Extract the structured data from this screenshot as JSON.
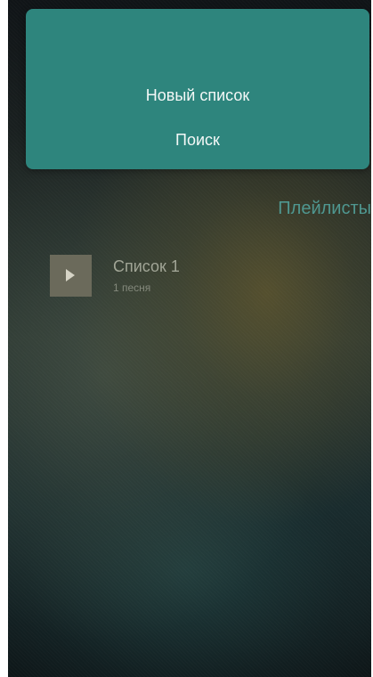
{
  "menu": {
    "new_list": "Новый список",
    "search": "Поиск"
  },
  "section": {
    "title": "Плейлисты"
  },
  "playlists": [
    {
      "name": "Список 1",
      "count": "1 песня",
      "icon": "play-icon"
    }
  ],
  "colors": {
    "menu_background": "#2e857d",
    "section_title": "#4f9790",
    "cover_background": "#6b6a5b"
  }
}
